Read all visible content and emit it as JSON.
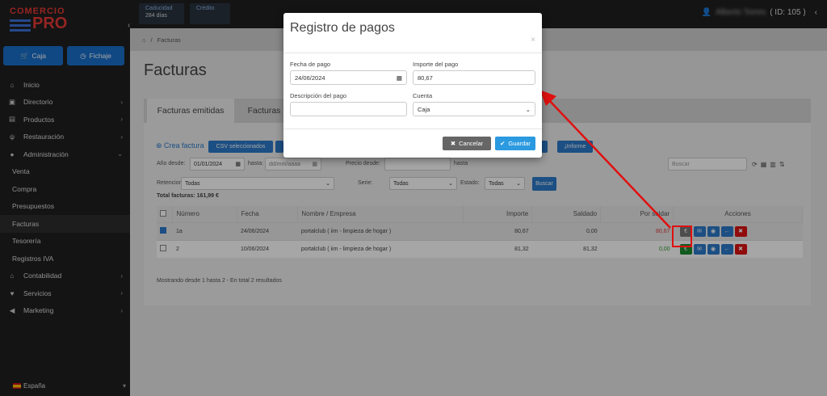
{
  "brand": {
    "line1": "COMERCIO",
    "line2": "PRO"
  },
  "sidebar": {
    "caja": "Caja",
    "fichaje": "Fichaje",
    "items": [
      {
        "label": "Inicio",
        "icon": "home-icon"
      },
      {
        "label": "Directorio",
        "icon": "address-book-icon"
      },
      {
        "label": "Productos",
        "icon": "box-icon"
      },
      {
        "label": "Restauración",
        "icon": "utensils-icon"
      },
      {
        "label": "Administración",
        "icon": "user-tie-icon"
      }
    ],
    "subitems": [
      "Venta",
      "Compra",
      "Presupuestos",
      "Facturas",
      "Tesorería",
      "Registros IVA"
    ],
    "items2": [
      {
        "label": "Contabilidad",
        "icon": "bank-icon"
      },
      {
        "label": "Servicios",
        "icon": "heart-icon"
      },
      {
        "label": "Marketing",
        "icon": "megaphone-icon"
      }
    ],
    "language": "España"
  },
  "topbar": {
    "card1_label": "Caducidad",
    "card1_value": "284 días",
    "card2_label": "Crédito",
    "user_id": "( ID: 105 )",
    "user_name": "Alberto Torres"
  },
  "breadcrumb": {
    "item": "Facturas"
  },
  "page": {
    "title": "Facturas"
  },
  "tabs": [
    "Facturas emitidas",
    "Facturas"
  ],
  "toolbar": {
    "crear": "Crea factura",
    "csv": "CSV seleccionados",
    "informe": "Informe"
  },
  "filters": {
    "anio_label": "Año desde:",
    "anio_from": "01/01/2024",
    "hasta_label": "hasta:",
    "anio_to": "dd/mm/aaaa",
    "precio_label": "Precio desde:",
    "precio_hasta": "hasta",
    "retencion_label": "Retencion:",
    "retencion": "Todas",
    "serie_label": "Serie:",
    "serie": "Todas",
    "estado_label": "Estado:",
    "estado": "Todas",
    "buscar": "Buscar",
    "search_placeholder": "Buscar",
    "total": "Total facturas: 161,99 €"
  },
  "table": {
    "headers": [
      "Número",
      "Fecha",
      "Nombre / Empresa",
      "Importe",
      "Saldado",
      "Por saldar",
      "Acciones"
    ],
    "rows": [
      {
        "numero": "1a",
        "fecha": "24/06/2024",
        "nombre": "portalclub ( iim - limpieza de hogar )",
        "importe": "80,67",
        "saldado": "0,00",
        "por_saldar": "80,67",
        "checked": true
      },
      {
        "numero": "2",
        "fecha": "10/06/2024",
        "nombre": "portalclub ( iim - limpieza de hogar )",
        "importe": "81,32",
        "saldado": "81,32",
        "por_saldar": "0,00",
        "checked": false
      }
    ],
    "footer": "Mostrando desde 1 hasta 2 - En total 2 resultados"
  },
  "modal": {
    "title": "Registro de pagos",
    "fecha_label": "Fecha de pago",
    "fecha_value": "24/06/2024",
    "importe_label": "Importe del pago",
    "importe_value": "80,67",
    "desc_label": "Descripción del pago",
    "desc_value": "",
    "cuenta_label": "Cuenta",
    "cuenta_value": "Caja",
    "cancelar": "Cancelar",
    "guardar": "Guardar"
  },
  "colors": {
    "accent": "#2b7ac9",
    "sidebar": "#1f1f1f",
    "highlight": "#e01010",
    "pos": "#2e9a2e",
    "neg": "#d33"
  }
}
